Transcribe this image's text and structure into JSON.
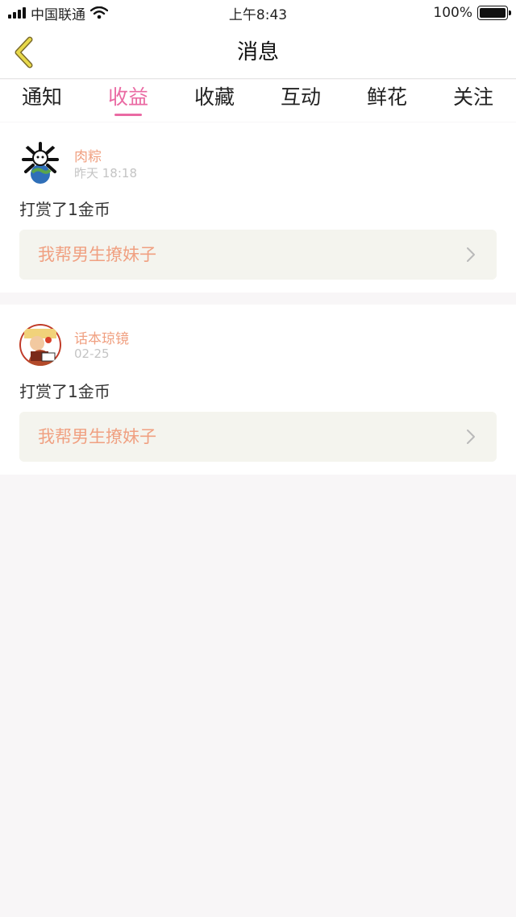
{
  "status_bar": {
    "carrier": "中国联通",
    "time": "上午8:43",
    "battery": "100%",
    "signal_icon": "signal-bars-icon",
    "wifi_icon": "wifi-icon",
    "battery_icon": "battery-icon"
  },
  "nav": {
    "title": "消息",
    "back_icon": "chevron-left-icon",
    "accent_color": "#e8d94a"
  },
  "tabs": {
    "items": [
      {
        "label": "通知"
      },
      {
        "label": "收益"
      },
      {
        "label": "收藏"
      },
      {
        "label": "互动"
      },
      {
        "label": "鲜花"
      },
      {
        "label": "关注"
      }
    ],
    "active": "收益",
    "active_color": "#ea6aa3"
  },
  "messages": [
    {
      "username": "肉粽",
      "time": "昨天 18:18",
      "text": "打赏了1金币",
      "link_title": "我帮男生撩妹子",
      "avatar_icon": "avatar-image"
    },
    {
      "username": "话本琼镜",
      "time": "02-25",
      "text": "打赏了1金币",
      "link_title": "我帮男生撩妹子",
      "avatar_icon": "avatar-image"
    }
  ],
  "colors": {
    "username": "#f0a081",
    "link_bg": "#f4f4ee",
    "page_bg": "#f8f6f7"
  }
}
